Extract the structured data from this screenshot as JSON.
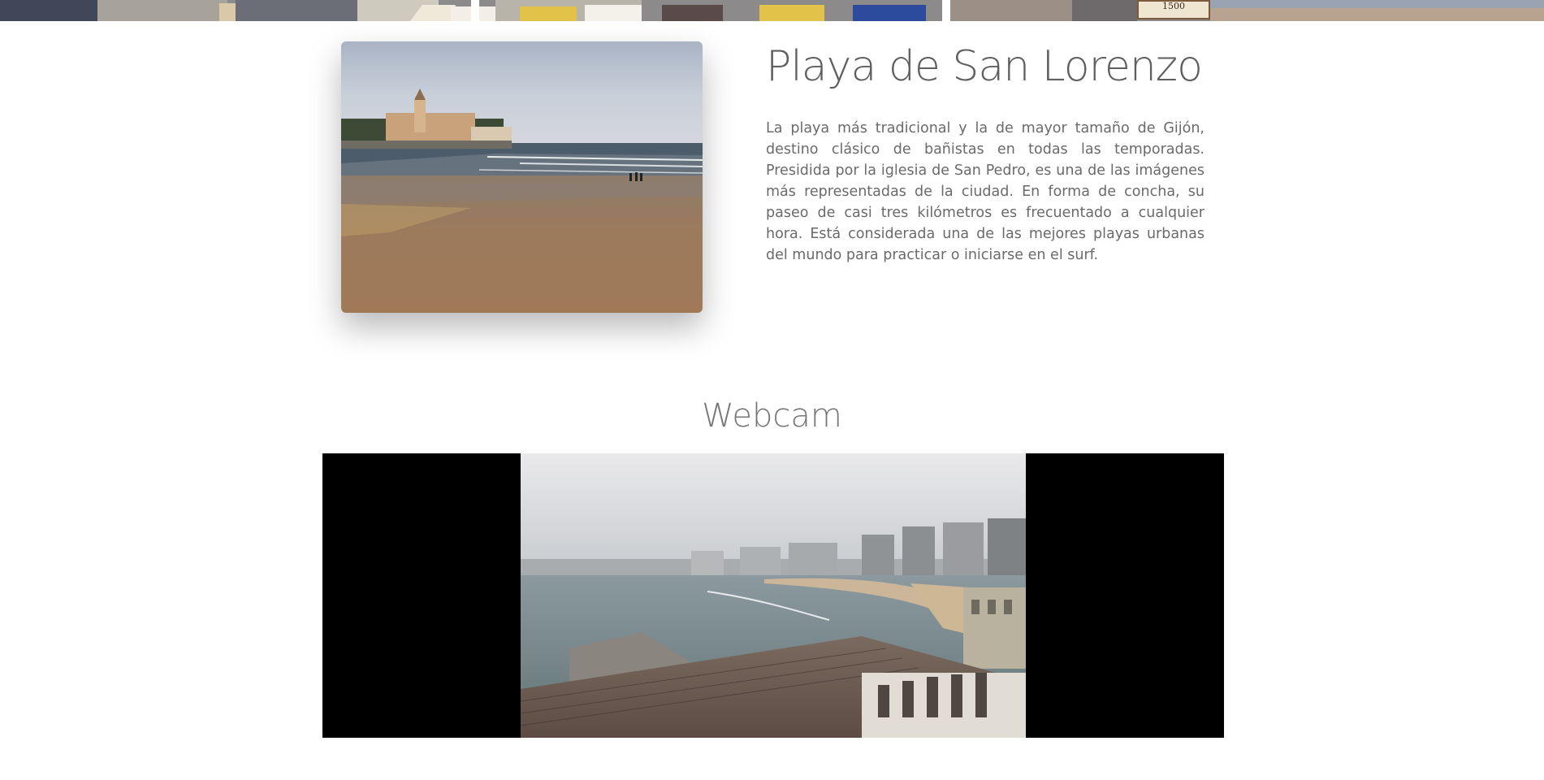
{
  "hero": {
    "sign_text": "1500"
  },
  "beach": {
    "title": "Playa de San Lorenzo",
    "description": "La playa más tradicional y la de mayor tamaño de Gijón, destino clásico de bañistas en todas las temporadas. Presidida por la iglesia de San Pedro, es una de las imágenes más representadas de la ciudad. En forma de concha, su paseo de casi tres kilómetros es frecuentado a cualquier hora. Está considerada una de las mejores playas urbanas del mundo para practicar o iniciarse en el surf."
  },
  "webcam": {
    "title": "Webcam"
  },
  "colors": {
    "title_text": "#5f5f5f",
    "body_text": "#6a6a6a",
    "webcam_title": "#777777",
    "webcam_background": "#000000"
  }
}
